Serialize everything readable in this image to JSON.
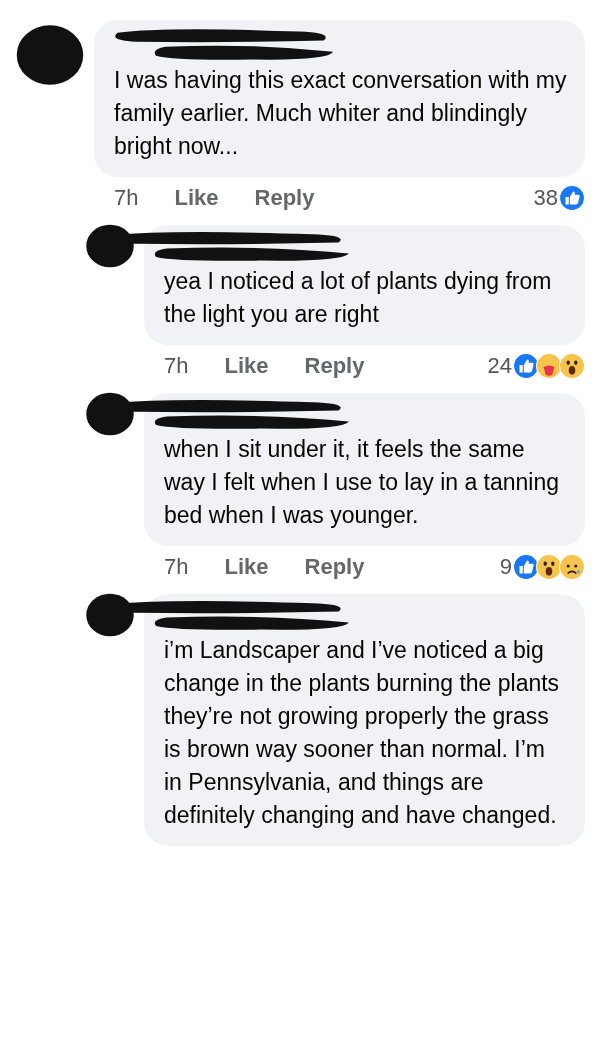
{
  "comments": [
    {
      "reply": false,
      "text": "I was having this exact conversation with my family earlier. Much whiter and blindingly bright now...",
      "time": "7h",
      "like": "Like",
      "reply_label": "Reply",
      "count": "38",
      "reactions": [
        {
          "kind": "like"
        }
      ]
    },
    {
      "reply": true,
      "text": "yea I noticed a lot of plants dying from the light you are right",
      "time": "7h",
      "like": "Like",
      "reply_label": "Reply",
      "count": "24",
      "reactions": [
        {
          "kind": "like"
        },
        {
          "kind": "care"
        },
        {
          "kind": "wow"
        }
      ]
    },
    {
      "reply": true,
      "text": "when I sit under it, it feels the same way I felt when I use to lay in a tanning bed when I was younger.",
      "time": "7h",
      "like": "Like",
      "reply_label": "Reply",
      "count": "9",
      "reactions": [
        {
          "kind": "like"
        },
        {
          "kind": "wow"
        },
        {
          "kind": "sad"
        }
      ]
    },
    {
      "reply": true,
      "text": "i’m Landscaper and I’ve noticed a big change in the plants burning the plants they’re not growing properly the grass is brown way sooner than normal. I’m in Pennsylvania, and things are definitely changing and have changed."
    }
  ]
}
